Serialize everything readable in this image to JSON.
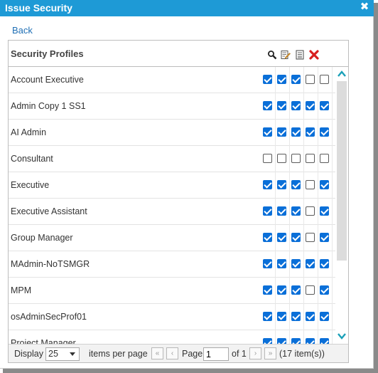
{
  "dialog": {
    "title": "Issue Security",
    "close_glyph": "✖",
    "back_label": "Back"
  },
  "grid": {
    "header": "Security Profiles",
    "permission_icons": [
      "view-icon",
      "edit-icon",
      "list-icon",
      "delete-icon"
    ],
    "rows": [
      {
        "name": "Account Executive",
        "checks": [
          true,
          true,
          true,
          false,
          false
        ]
      },
      {
        "name": "Admin Copy 1 SS1",
        "checks": [
          true,
          true,
          true,
          true,
          true
        ]
      },
      {
        "name": "AI Admin",
        "checks": [
          true,
          true,
          true,
          true,
          true
        ]
      },
      {
        "name": "Consultant",
        "checks": [
          false,
          false,
          false,
          false,
          false
        ]
      },
      {
        "name": "Executive",
        "checks": [
          true,
          true,
          true,
          false,
          true
        ]
      },
      {
        "name": "Executive Assistant",
        "checks": [
          true,
          true,
          true,
          false,
          true
        ]
      },
      {
        "name": "Group Manager",
        "checks": [
          true,
          true,
          true,
          false,
          true
        ]
      },
      {
        "name": "MAdmin-NoTSMGR",
        "checks": [
          true,
          true,
          true,
          true,
          true
        ]
      },
      {
        "name": "MPM",
        "checks": [
          true,
          true,
          true,
          false,
          true
        ]
      },
      {
        "name": "osAdminSecProf01",
        "checks": [
          true,
          true,
          true,
          true,
          true
        ]
      },
      {
        "name": "Project Manager",
        "checks": [
          true,
          true,
          true,
          true,
          true
        ]
      }
    ]
  },
  "pager": {
    "display_label": "Display",
    "page_size": "25",
    "items_per_page_label": "items per page",
    "page_label": "Page",
    "current_page": "1",
    "of_label": "of 1",
    "item_count": "(17 item(s))",
    "first_glyph": "«",
    "prev_glyph": "‹",
    "next_glyph": "›",
    "last_glyph": "»"
  },
  "colors": {
    "titlebar": "#1e9ad6",
    "checkbox_on": "#0a6fd8",
    "link": "#1f6fb5",
    "scroll_arrow": "#1aa0b8"
  }
}
